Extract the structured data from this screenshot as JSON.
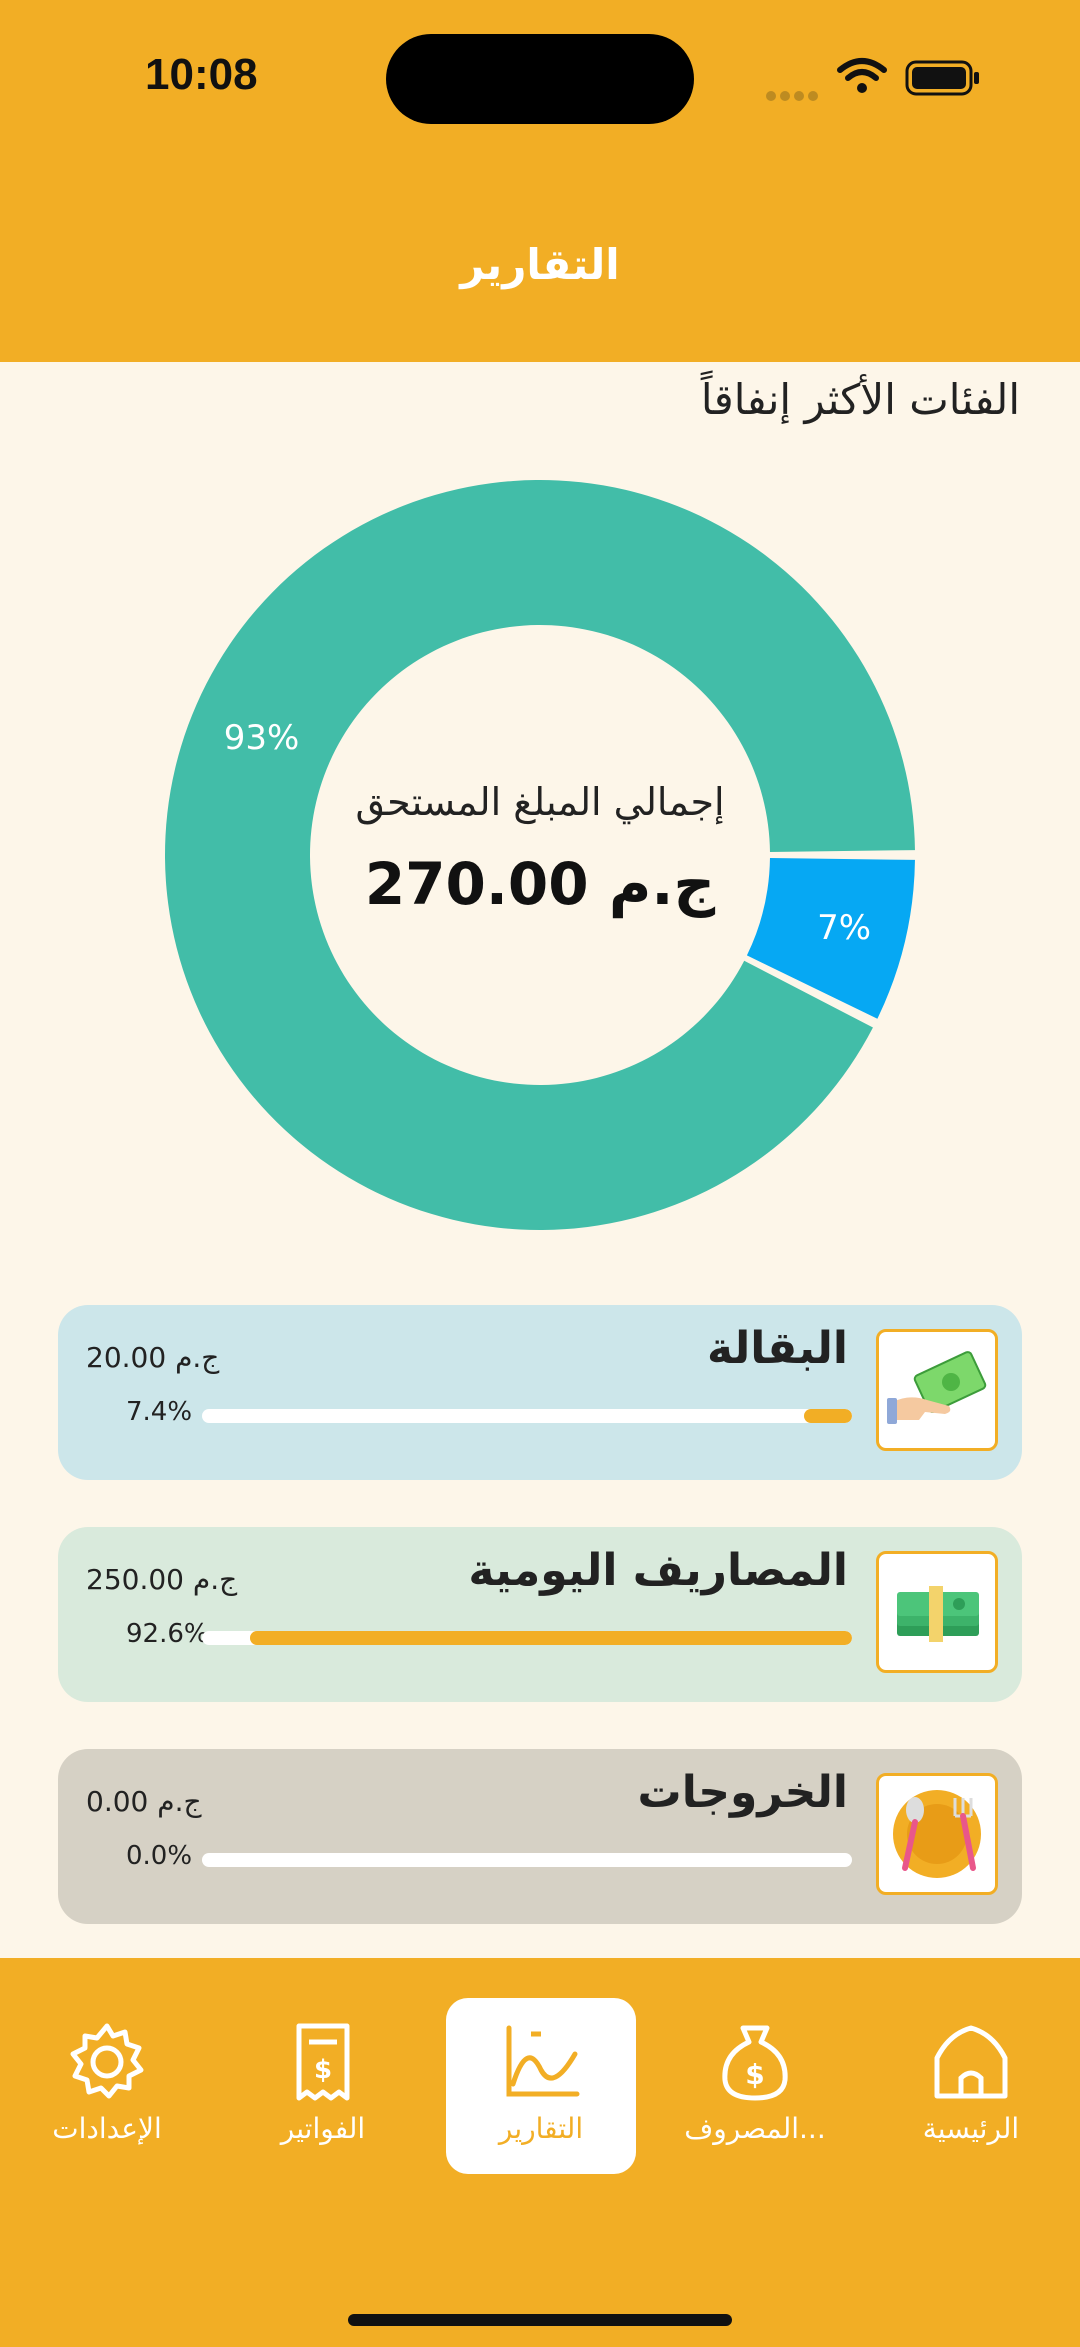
{
  "status": {
    "time": "10:08"
  },
  "header": {
    "title": "التقارير"
  },
  "section": {
    "title": "الفئات الأكثر إنفاقاً"
  },
  "chart_data": {
    "type": "pie",
    "donut": true,
    "center_label": "إجمالي المبلغ المستحق",
    "center_value": "270.00 ج.م",
    "slices": [
      {
        "label": "93%",
        "value": 92.6,
        "color": "#42BDA8"
      },
      {
        "label": "7%",
        "value": 7.4,
        "color": "#06A8F3"
      }
    ]
  },
  "categories": [
    {
      "name": "البقالة",
      "amount": "20.00 ج.م",
      "percent": "7.4%",
      "fill": 0.074,
      "bg": "#CCE6EA",
      "icon": "money-hand-icon"
    },
    {
      "name": "المصاريف اليومية",
      "amount": "250.00 ج.م",
      "percent": "92.6%",
      "fill": 0.926,
      "bg": "#D9EADC",
      "icon": "cash-stack-icon"
    },
    {
      "name": "الخروجات",
      "amount": "0.00 ج.م",
      "percent": "0.0%",
      "fill": 0.0,
      "bg": "#D6D1C5",
      "icon": "plate-cutlery-icon"
    }
  ],
  "tabs": {
    "settings": "الإعدادات",
    "bills": "الفواتير",
    "reports": "التقارير",
    "expenses": "المصروف...",
    "home": "الرئيسية"
  },
  "colors": {
    "accent": "#F2AE25",
    "background": "#FDF6E9"
  }
}
